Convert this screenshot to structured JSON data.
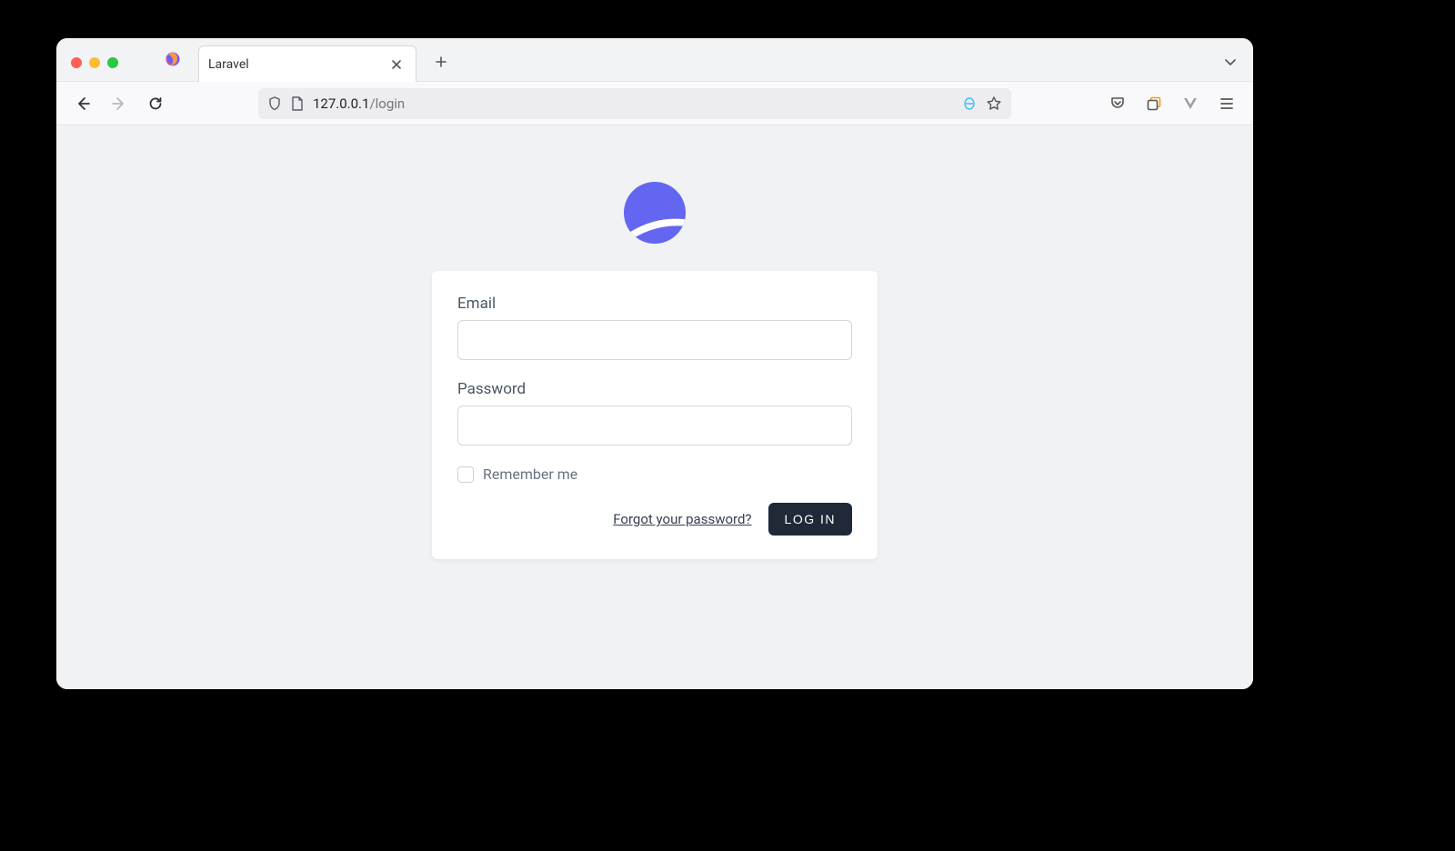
{
  "browser": {
    "tab_title": "Laravel",
    "url_host": "127.0.0.1",
    "url_path": "/login"
  },
  "login": {
    "email_label": "Email",
    "password_label": "Password",
    "remember_label": "Remember me",
    "forgot_label": "Forgot your password?",
    "submit_label": "LOG IN"
  }
}
